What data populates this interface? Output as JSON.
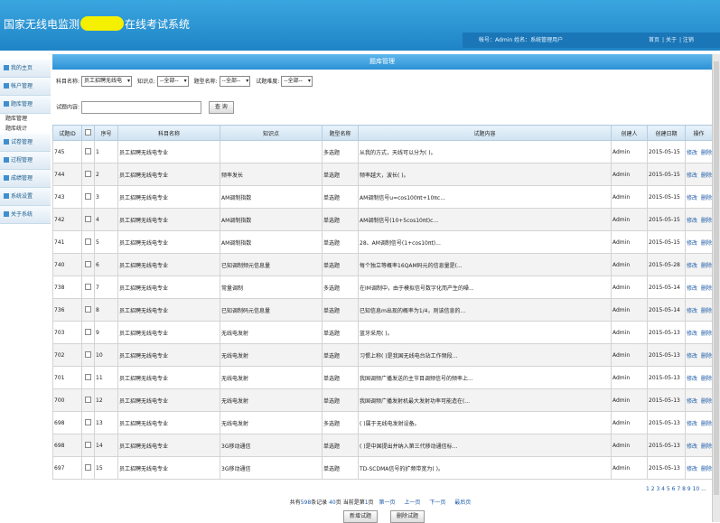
{
  "header": {
    "logo_left": "国家无线电监测",
    "logo_right": "在线考试系统",
    "account_label": "帐号：",
    "account_value": "Admin",
    "name_label": "姓名：",
    "name_value": "系统管理用户",
    "links": [
      "首页",
      "关于",
      "注销"
    ]
  },
  "sidebar": {
    "items": [
      {
        "label": "我的主页"
      },
      {
        "label": "帐户管理"
      },
      {
        "label": "题库管理"
      },
      {
        "label": "试卷管理"
      },
      {
        "label": "过程管理"
      },
      {
        "label": "成绩管理"
      },
      {
        "label": "系统设置"
      },
      {
        "label": "关于系统"
      }
    ],
    "subitems": [
      "题库管理",
      "题库统计"
    ]
  },
  "main": {
    "title": "题库管理",
    "filters": {
      "subject_label": "科目名称:",
      "subject_value": "员工招聘无线电",
      "knowledge_label": "知识点:",
      "knowledge_value": "--全部--",
      "type_label": "题型名称:",
      "type_value": "--全部--",
      "difficulty_label": "试题难度:",
      "difficulty_value": "--全部--"
    },
    "search": {
      "label": "试题内容:",
      "button": "查 询"
    },
    "table": {
      "headers": [
        "试题ID",
        "",
        "序号",
        "科目名称",
        "知识点",
        "题型名称",
        "试题内容",
        "创建人",
        "创建日期",
        "操作"
      ],
      "op_edit": "修改",
      "op_delete": "删除",
      "rows": [
        [
          "745",
          "1",
          "员工招聘无线电专业",
          "",
          "多选题",
          "从我的方式，天线可以分为( )。",
          "Admin",
          "2015-05-15"
        ],
        [
          "744",
          "2",
          "员工招聘无线电专业",
          "频率发长",
          "单选题",
          "频率越大，波长( )。",
          "Admin",
          "2015-05-15"
        ],
        [
          "743",
          "3",
          "员工招聘无线电专业",
          "AM调制指数",
          "单选题",
          "AM调制信号u=cos100πt+10πc...",
          "Admin",
          "2015-05-15"
        ],
        [
          "742",
          "4",
          "员工招聘无线电专业",
          "AM调制指数",
          "单选题",
          "AM调制信号(10+5cos10πt)c...",
          "Admin",
          "2015-05-15"
        ],
        [
          "741",
          "5",
          "员工招聘无线电专业",
          "AM调制指数",
          "单选题",
          "28、AM调制信号(1+cos10πt)...",
          "Admin",
          "2015-05-15"
        ],
        [
          "740",
          "6",
          "员工招聘无线电专业",
          "已知调制频元信息量",
          "单选题",
          "每个独立等概率16QAM码元的信息量是(...",
          "Admin",
          "2015-05-28"
        ],
        [
          "738",
          "7",
          "员工招聘无线电专业",
          "常量调制",
          "多选题",
          "在IM调制中，由于模拟信号数字化而产生的噪...",
          "Admin",
          "2015-05-14"
        ],
        [
          "736",
          "8",
          "员工招聘无线电专业",
          "已知调制码元信息量",
          "单选题",
          "已知信息m出现的概率为1/4，则该信息的...",
          "Admin",
          "2015-05-14"
        ],
        [
          "703",
          "9",
          "员工招聘无线电专业",
          "无线电发射",
          "单选题",
          "蓝牙采用( )。",
          "Admin",
          "2015-05-13"
        ],
        [
          "702",
          "10",
          "员工招聘无线电专业",
          "无线电发射",
          "单选题",
          "习惯上称( )是我国无线电台站工作频段...",
          "Admin",
          "2015-05-13"
        ],
        [
          "701",
          "11",
          "员工招聘无线电专业",
          "无线电发射",
          "单选题",
          "我国调频广播发送的主节目调频信号的频率上...",
          "Admin",
          "2015-05-13"
        ],
        [
          "700",
          "12",
          "员工招聘无线电专业",
          "无线电发射",
          "单选题",
          "我国调频广播发射机最大发射功率可能造在(...",
          "Admin",
          "2015-05-13"
        ],
        [
          "698",
          "13",
          "员工招聘无线电专业",
          "无线电发射",
          "多选题",
          "( )属于无线电发射设备。",
          "Admin",
          "2015-05-13"
        ],
        [
          "698",
          "14",
          "员工招聘无线电专业",
          "3G移动通信",
          "单选题",
          "( )是中国提出并纳入第三代移动通信标...",
          "Admin",
          "2015-05-13"
        ],
        [
          "697",
          "15",
          "员工招聘无线电专业",
          "3G移动通信",
          "单选题",
          "TD-SCDMA信号的扩频带宽为( )。",
          "Admin",
          "2015-05-13"
        ]
      ]
    },
    "pagination": {
      "summary_pre": "共有",
      "total": "598",
      "summary_mid": "条记录",
      "pages": "40",
      "pages_unit": "页",
      "current_pre": "当前是第",
      "current": "1",
      "current_unit": "页",
      "first": "第一页",
      "prev": "上一页",
      "next": "下一页",
      "last": "最后页",
      "page_numbers": "1 2 3 4 5 6 7 8 9 10 ..."
    },
    "buttons": {
      "add": "新增试题",
      "delete": "删除试题"
    }
  }
}
